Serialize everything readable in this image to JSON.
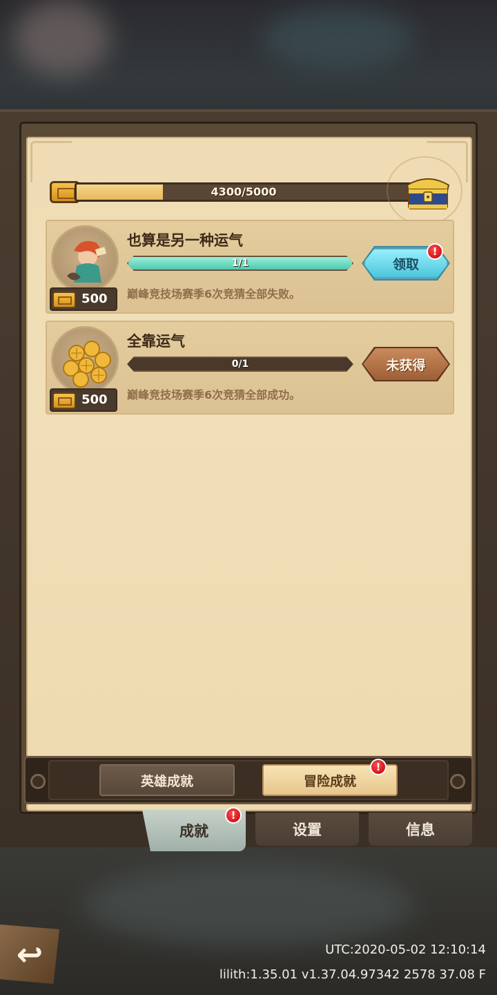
{
  "progress": {
    "label": "4300/5000",
    "value": 4300,
    "max": 5000
  },
  "achievements": [
    {
      "title": "也算是另一种运气",
      "progress_label": "1/1",
      "progress": 1.0,
      "description": "巅峰竞技场赛季6次竞猜全部失败。",
      "reward": "500",
      "action": "领取",
      "action_state": "claimable",
      "badge": "!"
    },
    {
      "title": "全靠运气",
      "progress_label": "0/1",
      "progress": 0.0,
      "description": "巅峰竞技场赛季6次竞猜全部成功。",
      "reward": "500",
      "action": "未获得",
      "action_state": "locked"
    }
  ],
  "subtabs": [
    {
      "label": "英雄成就",
      "active": false
    },
    {
      "label": "冒险成就",
      "active": true,
      "badge": "!"
    }
  ],
  "tabs": [
    {
      "label": "成就",
      "active": true,
      "badge": "!"
    },
    {
      "label": "设置",
      "active": false
    },
    {
      "label": "信息",
      "active": false
    }
  ],
  "back": {
    "icon": "back-arrow-icon",
    "glyph": "↩"
  },
  "footer": {
    "utc": "UTC:2020-05-02 12:10:14",
    "version": "lilith:1.35.01  v1.37.04.97342 2578 37.08 F"
  },
  "colors": {
    "paper": "#efdcb4",
    "claim_button": "#6fd6e8",
    "locked_button": "#b3744a",
    "badge": "#e0141e"
  }
}
